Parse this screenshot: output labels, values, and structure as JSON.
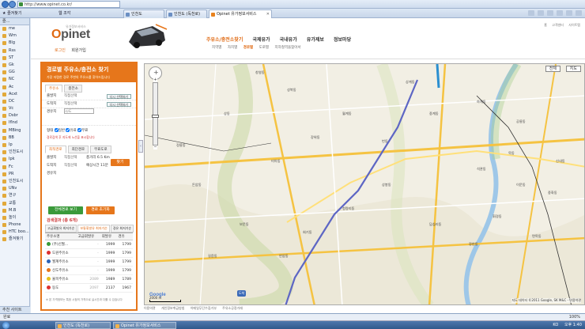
{
  "browser": {
    "url": "http://www.opinet.co.kr/",
    "favorites_label": "즐겨찾기",
    "favorites_bar_label": "웹 조각",
    "tabs": [
      {
        "label": "인천도"
      },
      {
        "label": "인천도 (독천로)"
      },
      {
        "label": "Opinet 유가정보서비스"
      }
    ]
  },
  "sidebar": {
    "header": "즐...",
    "items": [
      "me",
      "Wm",
      "Blg",
      "Rss",
      "ST",
      "Gk",
      "GG",
      "NC",
      "Ac",
      "Acxt",
      "DC",
      "Vc",
      "Dsbr",
      "Iflnd",
      "MBing",
      "BB",
      "Ip",
      "인천도시",
      "Ipk",
      "Fc",
      "PR",
      "인천도시",
      "UNv",
      "연구",
      "교통",
      "M.B",
      "놀이",
      "Phone",
      "HTC boo...",
      "즐겨찾기"
    ],
    "more": "추천 사이트"
  },
  "header": {
    "logo_sub": "유가정보서비스",
    "logo_o": "O",
    "logo_rest": "pinet",
    "login": "로그인",
    "join": "회원가입",
    "top_links": [
      "홈",
      "고객센터",
      "사이트맵"
    ],
    "nav": [
      "주유소/충전소찾기",
      "국제유가",
      "국내유가",
      "유가제보",
      "정보마당"
    ],
    "subnav": [
      "지역별",
      "자치별",
      "경로별",
      "도로별",
      "지하철역을찾아서"
    ]
  },
  "panel": {
    "title": "경로별 주유소/충전소 찾기",
    "subtitle": "가장 저렴한 경로 주변의 주유소를 찾아드립니다",
    "tabs": [
      "주유소",
      "충전소"
    ],
    "origin_label": "출발지",
    "origin_value": "직접선택",
    "dest_label": "도착지",
    "dest_value": "직접선택",
    "via_label": "경유지",
    "via_placeholder": "시/도",
    "select_btn": "다시 선택하기",
    "options_label": "형태",
    "opt1": "일반",
    "opt2": "유료",
    "opt3": "무료",
    "find_btn": "찾기",
    "note": "경로검색 후 지도에 노선을 표시합니다",
    "result_tabs": [
      "최적경로",
      "최단경로",
      "무료도로"
    ],
    "res_origin": "직접선택",
    "res_dest": "직접선택",
    "res_dist_label": "총거리",
    "res_dist": "6.5 Km",
    "res_time_label": "예상시간",
    "res_time": "11분",
    "btn_route": "전체경로 보기",
    "btn_reset": "경로 초기화",
    "list_title": "검색결과 (총 6개)",
    "list_tabs": [
      "고급휘발유 최저가순",
      "보통휘발유 최저가순",
      "경유 최저가순"
    ],
    "table_head": [
      "주유소명",
      "고급휘발유",
      "휘발유",
      "경유"
    ],
    "stations": [
      {
        "name": "(주)신월...",
        "p1": "-",
        "p2": "1999",
        "p3": "1799",
        "color": "#3a9a3a"
      },
      {
        "name": "도원주유소",
        "p1": "-",
        "p2": "1999",
        "p3": "1799",
        "color": "#d33"
      },
      {
        "name": "월계주유소",
        "p1": "-",
        "p2": "1999",
        "p3": "1799",
        "color": "#2b63b8"
      },
      {
        "name": "신도주유소",
        "p1": "-",
        "p2": "1999",
        "p3": "1799",
        "color": "#e6761b"
      },
      {
        "name": "율목주유소",
        "p1": "2089",
        "p2": "1989",
        "p3": "1789",
        "color": "#e6c21b"
      },
      {
        "name": "동도",
        "p1": "2097",
        "p2": "2137",
        "p3": "1967",
        "color": "#d33"
      }
    ],
    "bottom_note": "※ 본 가격정보는 특정 시점의 가격으로 실시간과 다를 수 있습니다"
  },
  "map": {
    "type_btns": [
      "전체",
      "지도"
    ],
    "google": "Google",
    "scale": "2000 m",
    "copyright": "지도 데이터 ©2011 Google, SK M&C - 이용약관",
    "start_pin": "도착",
    "labels": [
      "창영동",
      "성북동",
      "상계동",
      "중계동",
      "하계동",
      "공릉동",
      "월계동",
      "상동",
      "장위동",
      "번동",
      "미아동",
      "석관동",
      "이문동",
      "휘경동",
      "답십리동",
      "장안동",
      "면목동",
      "중화동",
      "신내동",
      "묵동",
      "상봉동",
      "청량리동",
      "회기동",
      "안암동",
      "보문동",
      "돈암동",
      "정릉동",
      "길음동"
    ]
  },
  "footer": {
    "links": [
      "이용약관",
      "개인정보취급방침",
      "이메일무단수집거부",
      "주유소공정거래"
    ]
  },
  "status": {
    "text": "완료",
    "zoom": "100%"
  },
  "taskbar": {
    "items": [
      "인천도 (독천로)",
      "Opinet 유가정보서비스"
    ],
    "tray": [
      "KO",
      "오후 1:40"
    ]
  }
}
